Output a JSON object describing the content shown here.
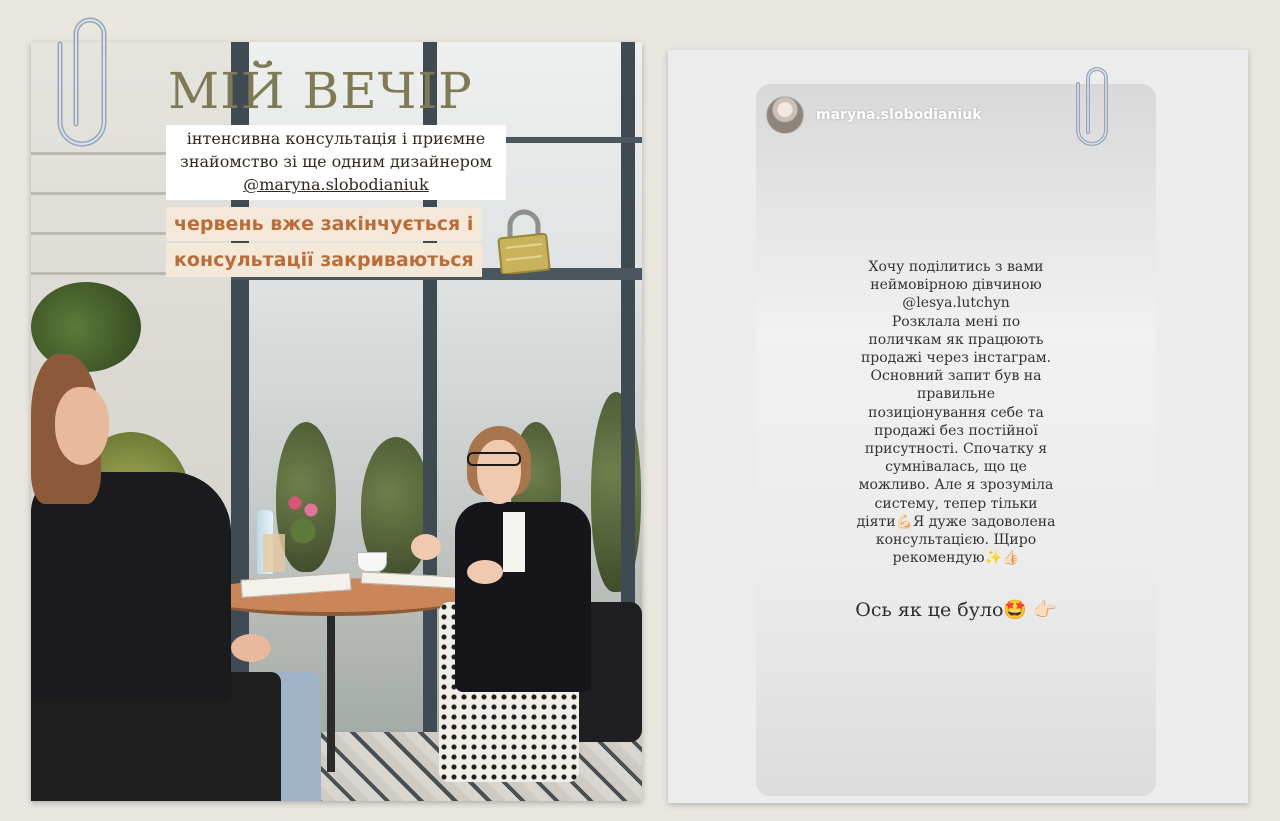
{
  "left_card": {
    "title": "МІЙ ВЕЧІР",
    "caption": {
      "line1": "інтенсивна консультація і приємне",
      "line2": "знайомство зі ще одним дизайнером",
      "handle": "@maryna.slobodianiuk"
    },
    "highlight": {
      "line1": "червень вже закінчується і",
      "line2": "консультації закриваються"
    },
    "lock_icon": "padlock-icon"
  },
  "right_card": {
    "username": "maryna.slobodianiuk",
    "avatar_icon": "profile-avatar",
    "story_lines": [
      "Хочу поділитись з вами",
      "неймовірною дівчиною",
      "@lesya.lutchyn",
      "Розклала мені по",
      "поличкам як працюють",
      "продажі через інстаграм.",
      "Основний запит був на",
      "правильне",
      "позиціонування себе та",
      "продажі без постійної",
      "присутності. Спочатку я",
      "сумнівалась, що це",
      "можливо. Але я зрозуміла",
      "систему, тепер тільки",
      "діяти💪🏻Я дуже задоволена",
      "консультацією. Щиро",
      "рекомендую✨👍🏻"
    ],
    "cta": "Ось як це було🤩 👉🏻"
  },
  "decor": {
    "paperclip_icon": "paperclip-icon",
    "background_color": "#e9e6e0",
    "title_color": "#7e7a55",
    "highlight_text_color": "#b86d3b",
    "highlight_bg_color": "#f4e8d8"
  }
}
